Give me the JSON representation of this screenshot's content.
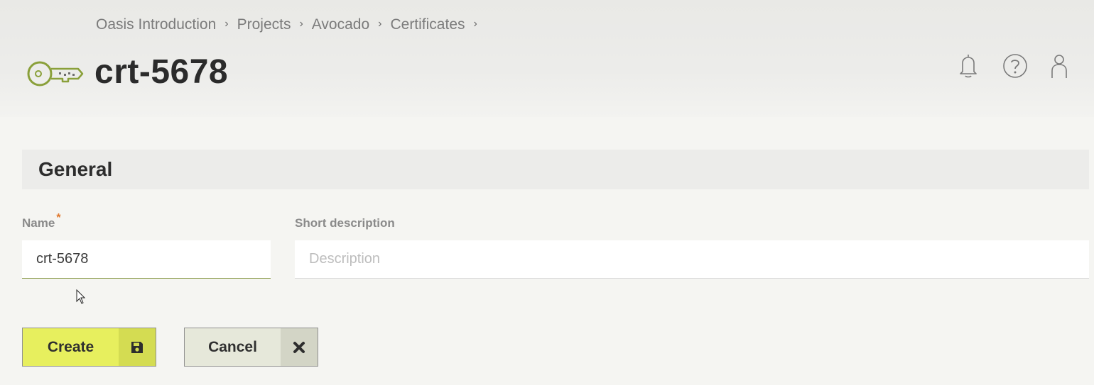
{
  "breadcrumb": {
    "items": [
      "Oasis Introduction",
      "Projects",
      "Avocado",
      "Certificates"
    ],
    "separator": "›"
  },
  "page": {
    "title": "crt-5678"
  },
  "header_icons": [
    "bell-icon",
    "help-icon",
    "user-icon"
  ],
  "section": {
    "title": "General"
  },
  "form": {
    "name": {
      "label": "Name",
      "required_mark": "*",
      "value": "crt-5678"
    },
    "short_description": {
      "label": "Short description",
      "placeholder": "Description",
      "value": ""
    }
  },
  "buttons": {
    "create": {
      "label": "Create",
      "icon": "save-icon"
    },
    "cancel": {
      "label": "Cancel",
      "icon": "close-icon"
    }
  },
  "colors": {
    "accent_green": "#8aa03a",
    "create_bg": "#e7ef5e",
    "cancel_bg": "#e6e8da",
    "required": "#e0762a"
  }
}
